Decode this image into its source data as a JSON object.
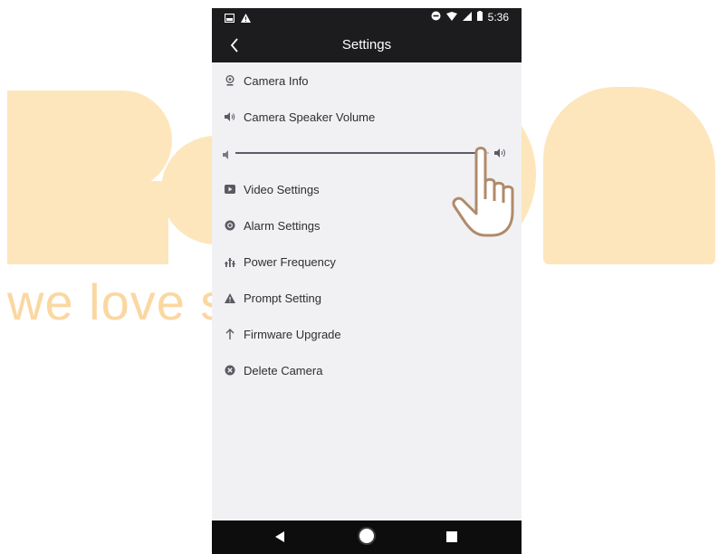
{
  "watermark": {
    "tagline": "we love smart",
    "color": "#fde6bb"
  },
  "status_bar": {
    "time": "5:36",
    "icons": [
      "image-notification-icon",
      "warning-icon",
      "do-not-disturb-icon",
      "wifi-icon",
      "signal-icon",
      "battery-icon"
    ]
  },
  "app_bar": {
    "title": "Settings",
    "back_icon": "chevron-left-icon"
  },
  "settings": {
    "items": [
      {
        "label": "Camera Info",
        "icon": "camera-info-icon"
      },
      {
        "label": "Camera Speaker Volume",
        "icon": "speaker-icon"
      },
      {
        "label": "Video Settings",
        "icon": "video-icon"
      },
      {
        "label": "Alarm Settings",
        "icon": "alarm-icon"
      },
      {
        "label": "Power Frequency",
        "icon": "frequency-icon"
      },
      {
        "label": "Prompt Setting",
        "icon": "prompt-warning-icon"
      },
      {
        "label": "Firmware Upgrade",
        "icon": "upgrade-arrow-icon"
      },
      {
        "label": "Delete Camera",
        "icon": "delete-icon"
      }
    ],
    "volume_level": 0.97
  },
  "nav_bar": {
    "buttons": [
      "back-triangle-icon",
      "home-circle-icon",
      "recents-square-icon"
    ]
  },
  "colors": {
    "screen_background": "#f1f1f3",
    "bar_background": "#1c1c1e",
    "text": "#2e2e33",
    "hand_outline": "#b08a6a"
  }
}
